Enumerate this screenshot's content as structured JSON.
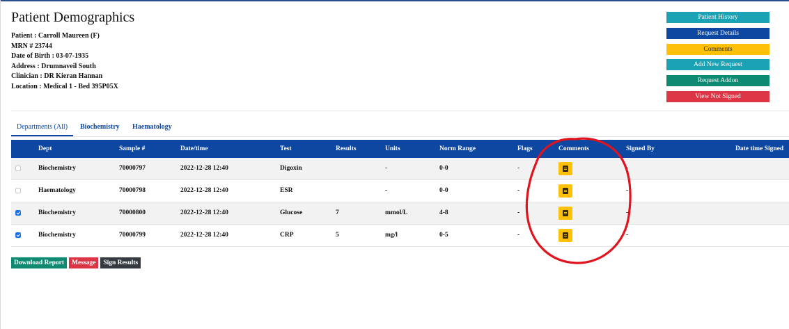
{
  "header": {
    "title": "Patient Demographics",
    "patient": "Patient : Carroll Maureen (F)",
    "mrn": "MRN # 23744",
    "dob": "Date of Birth : 03-07-1935",
    "address": "Address : Drumnaveil South",
    "clinician": "Clinician : DR Kieran Hannan",
    "location": "Location : Medical 1 - Bed 395P05X"
  },
  "side_buttons": {
    "patient_history": "Patient History",
    "request_details": "Request Details",
    "comments": "Comments",
    "add_new_request": "Add New Request",
    "request_addon": "Request Addon",
    "view_not_signed": "View Not Signed"
  },
  "tabs": {
    "departments_all": "Departments (All)",
    "biochemistry": "Biochemistry",
    "haematology": "Haematology"
  },
  "table": {
    "headers": {
      "dept": "Dept",
      "sample": "Sample #",
      "datetime": "Date/time",
      "test": "Test",
      "results": "Results",
      "units": "Units",
      "norm_range": "Norm Range",
      "flags": "Flags",
      "comments": "Comments",
      "signed_by": "Signed By",
      "datetime_signed": "Date time Signed"
    },
    "rows": [
      {
        "checked": false,
        "dept": "Biochemistry",
        "sample": "70000797",
        "datetime": "2022-12-28 12:40",
        "test": "Digoxin",
        "results": "",
        "units": "-",
        "norm_range": "0-0",
        "flags": "-",
        "signed_by": "-",
        "datetime_signed": ""
      },
      {
        "checked": false,
        "dept": "Haematology",
        "sample": "70000798",
        "datetime": "2022-12-28 12:40",
        "test": "ESR",
        "results": "",
        "units": "-",
        "norm_range": "0-0",
        "flags": "-",
        "signed_by": "-",
        "datetime_signed": ""
      },
      {
        "checked": true,
        "dept": "Biochemistry",
        "sample": "70000800",
        "datetime": "2022-12-28 12:40",
        "test": "Glucose",
        "results": "7",
        "units": "mmol/L",
        "norm_range": "4-8",
        "flags": "-",
        "signed_by": "-",
        "datetime_signed": ""
      },
      {
        "checked": true,
        "dept": "Biochemistry",
        "sample": "70000799",
        "datetime": "2022-12-28 12:40",
        "test": "CRP",
        "results": "5",
        "units": "mg/l",
        "norm_range": "0-5",
        "flags": "-",
        "signed_by": "-",
        "datetime_signed": ""
      }
    ]
  },
  "actions": {
    "download_report": "Download Report",
    "message": "Message",
    "sign_results": "Sign Results"
  },
  "colors": {
    "navy": "#0d47a1",
    "teal": "#1ba2b5",
    "yellow": "#ffc107",
    "green": "#0e8a73",
    "red": "#dc3545",
    "dark": "#343a40",
    "annotation_red": "#e0141e"
  },
  "icons": {
    "comment_button_icon": "comment-icon"
  }
}
